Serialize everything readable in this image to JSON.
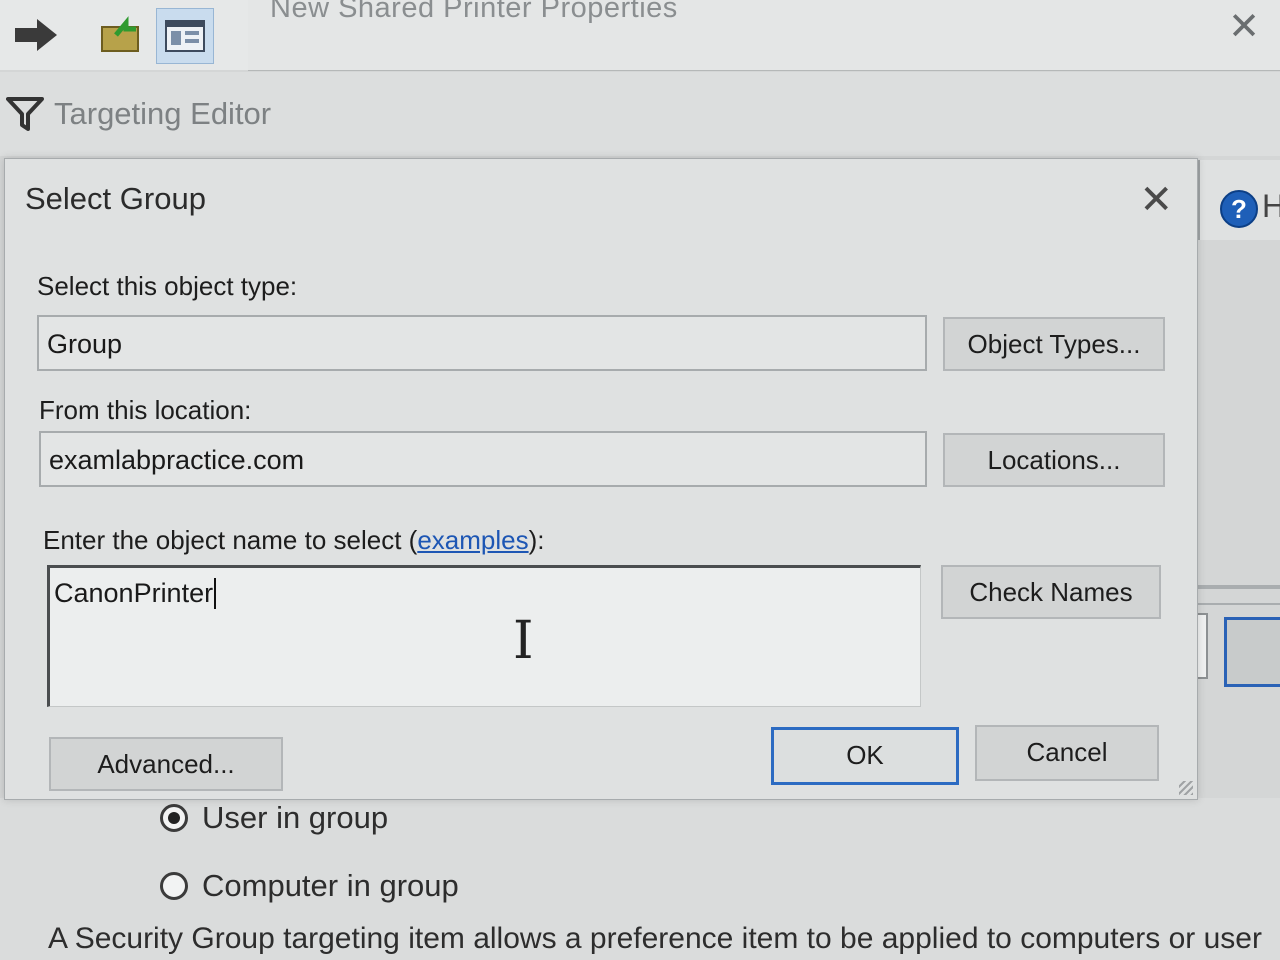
{
  "toolbar": {
    "buttons": [
      {
        "icon": "forward-arrow-icon"
      },
      {
        "icon": "folder-up-icon"
      },
      {
        "icon": "window-layout-icon"
      }
    ]
  },
  "window": {
    "title": "New Shared Printer Properties"
  },
  "targeting_editor": {
    "title": "Targeting Editor",
    "icon": "filter-icon"
  },
  "help": {
    "icon": "help-icon",
    "label": "H"
  },
  "dialog": {
    "title": "Select Group",
    "object_type_label": "Select this object type:",
    "object_type_value": "Group",
    "object_types_button": "Object Types...",
    "location_label": "From this location:",
    "location_value": "examlabpractice.com",
    "locations_button": "Locations...",
    "object_name_label_prefix": "Enter the object name to select (",
    "object_name_label_link": "examples",
    "object_name_label_suffix": "):",
    "object_name_value": "CanonPrinter",
    "check_names_button": "Check Names",
    "advanced_button": "Advanced...",
    "ok_button": "OK",
    "cancel_button": "Cancel"
  },
  "underpage": {
    "radio_user": "User in group",
    "radio_computer": "Computer in group",
    "description": "A Security Group targeting item allows a preference item to be applied to computers or user"
  }
}
